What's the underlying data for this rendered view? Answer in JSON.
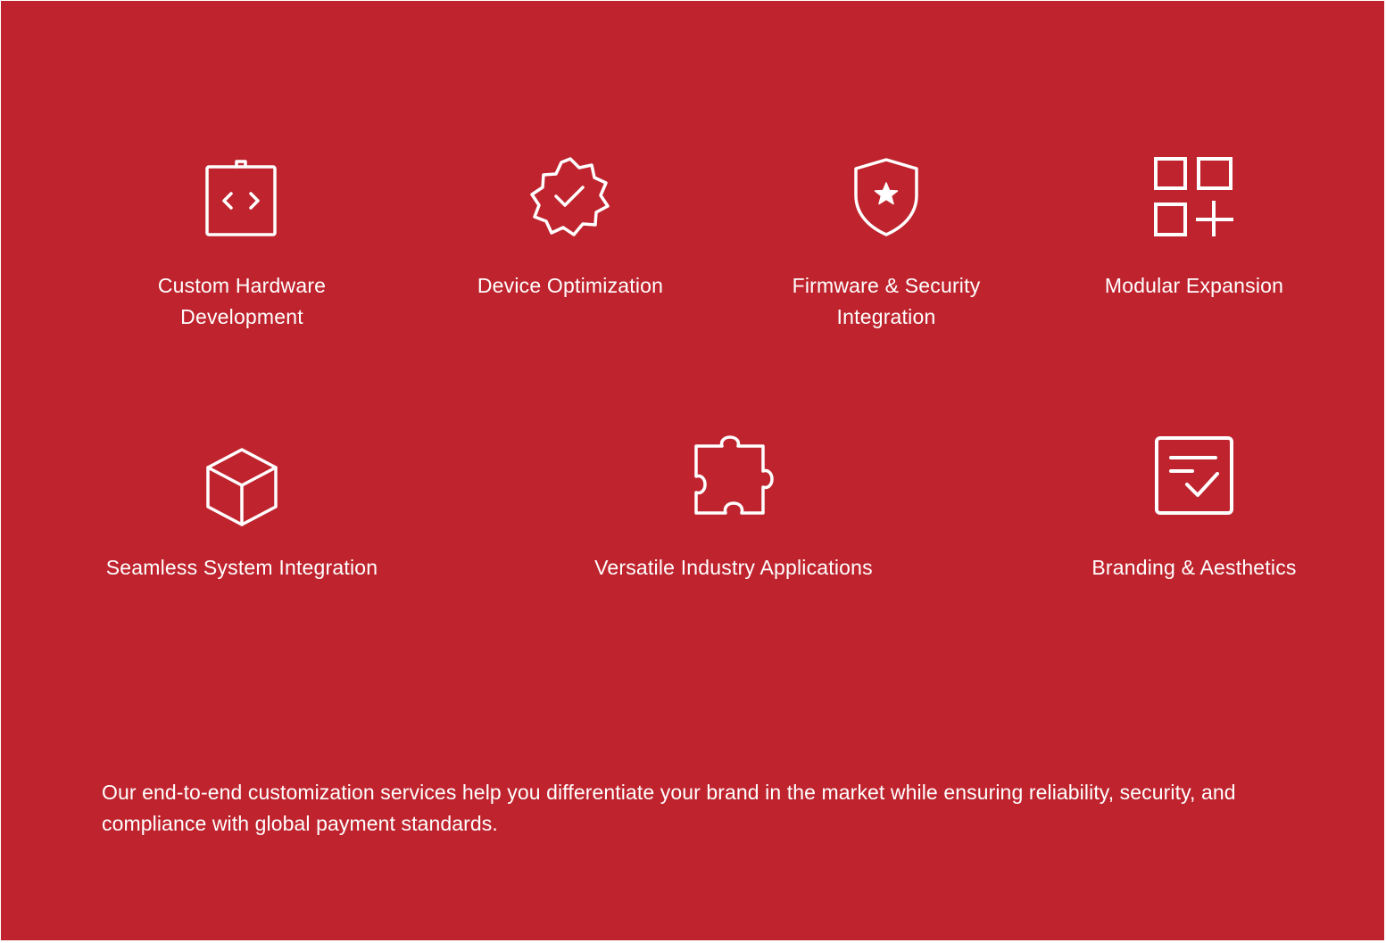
{
  "colors": {
    "background": "#BF242E",
    "foreground": "#FFFFFF"
  },
  "features_row1": [
    {
      "icon": "code-clipboard-icon",
      "label": "Custom Hardware Development"
    },
    {
      "icon": "verified-badge-icon",
      "label": "Device Optimization"
    },
    {
      "icon": "shield-star-icon",
      "label": "Firmware & Security Integration"
    },
    {
      "icon": "add-module-grid-icon",
      "label": "Modular Expansion"
    }
  ],
  "features_row2": [
    {
      "icon": "cube-icon",
      "label": "Seamless System Integration"
    },
    {
      "icon": "puzzle-piece-icon",
      "label": "Versatile Industry Applications"
    },
    {
      "icon": "checklist-icon",
      "label": "Branding & Aesthetics"
    }
  ],
  "description": "Our end-to-end customization services help you differentiate your brand in the market while ensuring reliability, security, and compliance with global payment standards."
}
